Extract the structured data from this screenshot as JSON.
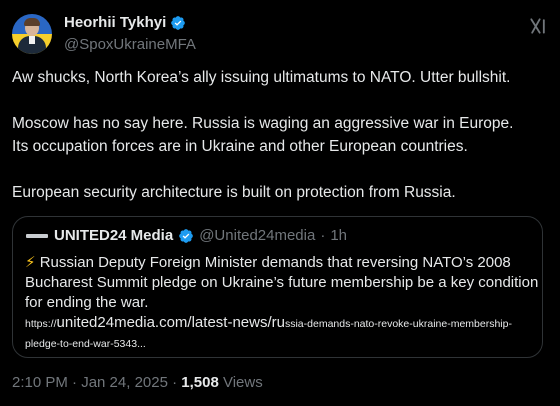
{
  "author": {
    "display_name": "Heorhii Tykhyi",
    "handle": "@SpoxUkraineMFA"
  },
  "tweet": {
    "line1": "Aw shucks, North Korea’s ally issuing ultimatums to NATO. Utter bullshit.",
    "line2": "Moscow has no say here. Russia is waging an aggressive war in Europe.",
    "line3": "Its occupation forces are in Ukraine and other European countries.",
    "line4": "European security architecture is built on protection from Russia."
  },
  "quote": {
    "display_name": "UNITED24 Media",
    "handle": "@United24media",
    "separator": "·",
    "time": "1h",
    "bolt": "⚡",
    "line1": " Russian Deputy Foreign Minister demands that reversing NATO’s 2008",
    "line2": "Bucharest Summit pledge on Ukraine’s future membership be a key condition",
    "line3": "for ending the war.",
    "url_prefix": "https://",
    "url_main": "united24media.com/latest-news/ru",
    "url_rest": "ssia-demands-nato-revoke-ukraine-membership-",
    "url_line2": "pledge-to-end-war-5343..."
  },
  "meta": {
    "timestamp": "2:10 PM · Jan 24, 2025 · ",
    "views_count": "1,508",
    "views_label": " Views"
  },
  "colors": {
    "background": "#000000",
    "text": "#e7e9ea",
    "muted": "#71767b",
    "verified": "#1d9bf0",
    "border": "#2f3336"
  }
}
